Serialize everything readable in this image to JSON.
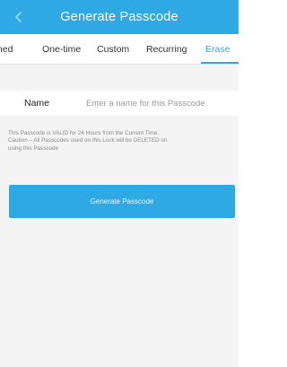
{
  "header": {
    "title": "Generate Passcode",
    "back_icon": "chevron-left-icon",
    "background_color": "#2fa9e3"
  },
  "tabs": [
    {
      "label": "med",
      "active": false
    },
    {
      "label": "One-time",
      "active": false
    },
    {
      "label": "Custom",
      "active": false
    },
    {
      "label": "Recurring",
      "active": false
    },
    {
      "label": "Erase",
      "active": true
    }
  ],
  "form": {
    "name_label": "Name",
    "name_placeholder": "Enter a name for this Passcode"
  },
  "info": {
    "line1": "This Passcode is VALID for 24 Hours from the Current Time.",
    "line2": "Caution – All Passcodes used on this Lock will be DELETED on",
    "line3": "using this Passcode"
  },
  "actions": {
    "generate_label": "Generate Passcode"
  },
  "colors": {
    "accent": "#2fa9e3",
    "page_background": "#f4f4f4"
  }
}
